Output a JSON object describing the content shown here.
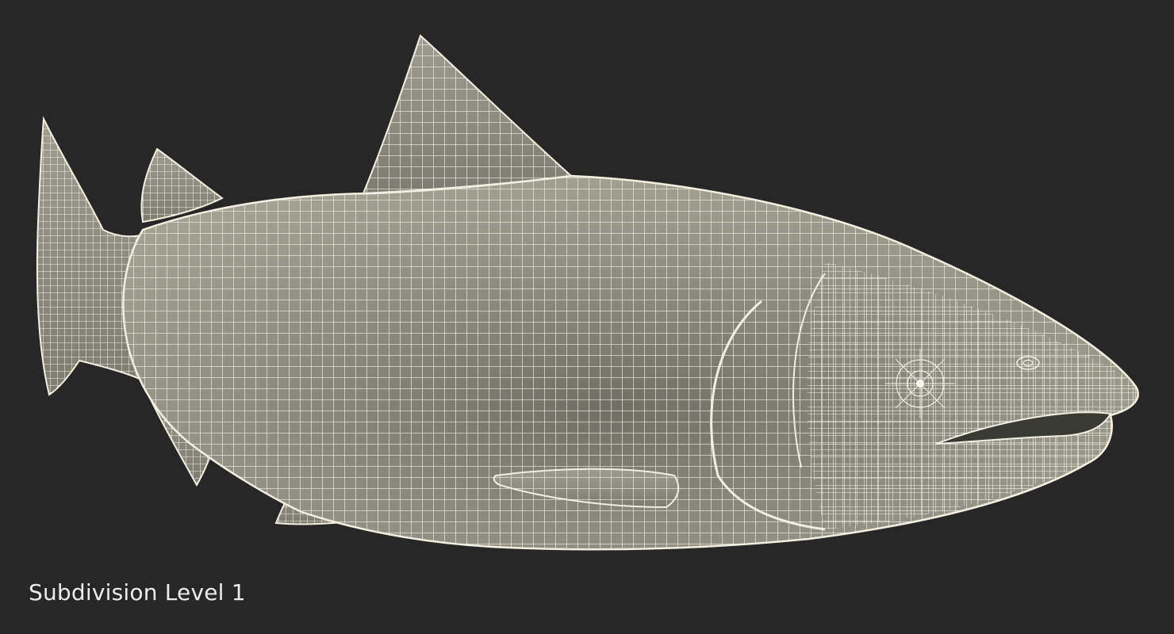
{
  "viewport": {
    "background_color": "#272727",
    "caption": "Subdivision Level 1"
  },
  "model": {
    "subject": "fish-wireframe-icon",
    "wire_color": "#f2efe0",
    "surface_color": "#8a8a7c",
    "shadow_color": "#5a5a50"
  }
}
